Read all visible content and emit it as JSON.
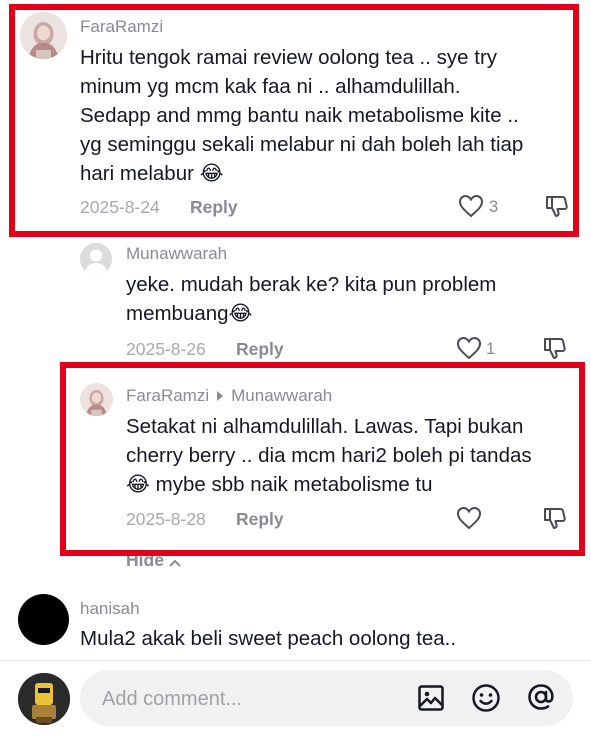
{
  "comment1": {
    "username": "FaraRamzi",
    "text_lines": [
      "Hritu tengok ramai review oolong tea .. sye try",
      "minum yg mcm kak faa ni .. alhamdulillah.",
      "Sedapp and mmg bantu naik metabolisme kite ..",
      "yg seminggu sekali melabur ni dah boleh lah tiap",
      "hari melabur 😂"
    ],
    "date": "2025-8-24",
    "reply_label": "Reply",
    "like_count": "3"
  },
  "reply1": {
    "username": "Munawwarah",
    "text_lines": [
      "yeke. mudah berak ke? kita pun problem",
      "membuang😂"
    ],
    "date": "2025-8-26",
    "reply_label": "Reply",
    "like_count": "1"
  },
  "reply2": {
    "username": "FaraRamzi",
    "reply_to": "Munawwarah",
    "text_lines": [
      "Setakat ni alhamdulillah. Lawas. Tapi bukan",
      "cherry berry .. dia mcm hari2 boleh pi tandas",
      "😂 mybe sbb naik metabolisme tu"
    ],
    "date": "2025-8-28",
    "reply_label": "Reply"
  },
  "hide_label": "Hide",
  "comment2": {
    "username": "hanisah",
    "text": "Mula2 akak beli sweet peach oolong tea.."
  },
  "input": {
    "placeholder": "Add comment..."
  },
  "icons": {
    "like": "heart-icon",
    "dislike": "thumbs-down-icon",
    "image": "image-icon",
    "emoji": "smiley-icon",
    "mention": "at-icon"
  },
  "colors": {
    "highlight_border": "#e2001a",
    "input_bg": "#f1f1f2"
  }
}
